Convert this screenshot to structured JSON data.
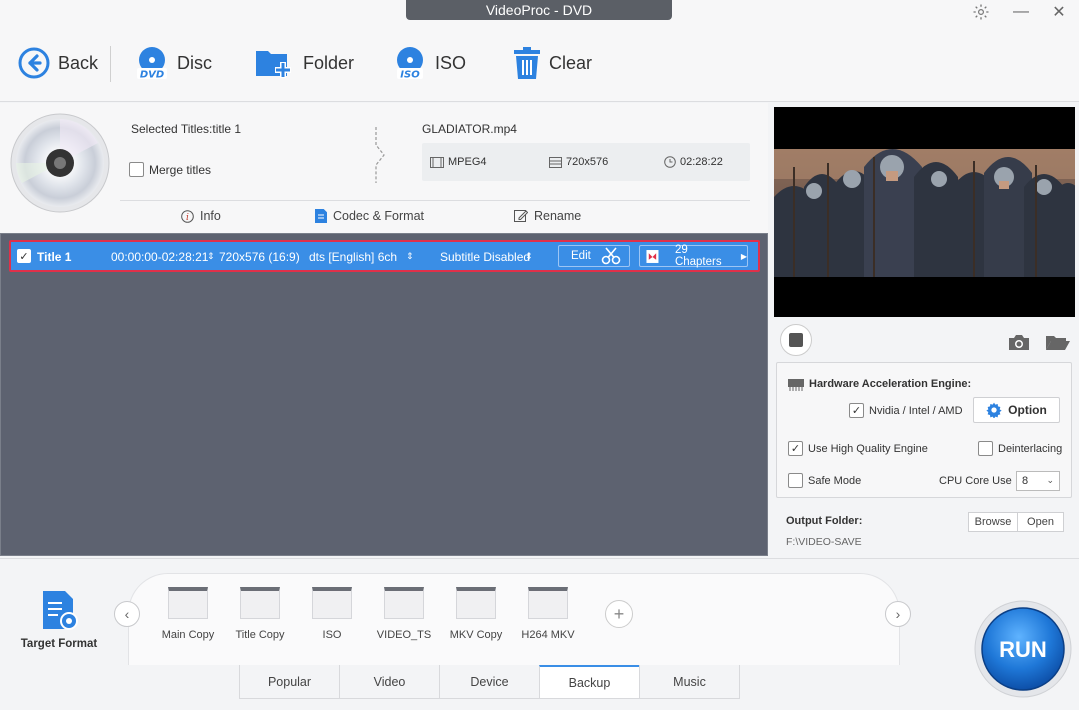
{
  "window": {
    "title": "VideoProc - DVD",
    "minimize": "—",
    "close": "✕"
  },
  "toolbar": {
    "back": "Back",
    "disc": "Disc",
    "folder": "Folder",
    "iso": "ISO",
    "clear": "Clear"
  },
  "source": {
    "selected_titles": "Selected Titles:title 1",
    "merge_titles": "Merge titles",
    "filename": "GLADIATOR.mp4",
    "format": "MPEG4",
    "resolution": "720x576",
    "duration": "02:28:22",
    "tabs": {
      "info": "Info",
      "codec": "Codec & Format",
      "rename": "Rename"
    }
  },
  "title_row": {
    "name": "Title 1",
    "time_range": "00:00:00-02:28:21",
    "resolution": "720x576 (16:9)",
    "audio": "dts [English] 6ch",
    "subtitle": "Subtitle Disabled",
    "edit": "Edit",
    "chapters": "29 Chapters"
  },
  "settings": {
    "hw_engine": "Hardware Acceleration Engine:",
    "nvidia": "Nvidia / Intel / AMD",
    "option": "Option",
    "high_quality": "Use High Quality Engine",
    "deinterlacing": "Deinterlacing",
    "safe_mode": "Safe Mode",
    "cpu_core": "CPU Core Use",
    "cpu_value": "8"
  },
  "output": {
    "label": "Output Folder:",
    "path": "F:\\VIDEO-SAVE",
    "browse": "Browse",
    "open": "Open"
  },
  "format_bar": {
    "target_format": "Target Format",
    "items": [
      "Main Copy",
      "Title Copy",
      "ISO",
      "VIDEO_TS",
      "MKV Copy",
      "H264 MKV"
    ],
    "tabs": [
      "Popular",
      "Video",
      "Device",
      "Backup",
      "Music"
    ],
    "active_tab": "Backup",
    "run": "RUN"
  },
  "colors": {
    "accent": "#3a8ee6",
    "row_border": "#e0304a",
    "list_bg": "#5d6270",
    "title_bg": "#5b5f66"
  },
  "icons": {
    "back": "back-arrow-icon",
    "disc": "dvd-disc-icon",
    "folder": "folder-add-icon",
    "iso": "iso-disc-icon",
    "clear": "trash-icon",
    "settings": "gear-icon"
  }
}
